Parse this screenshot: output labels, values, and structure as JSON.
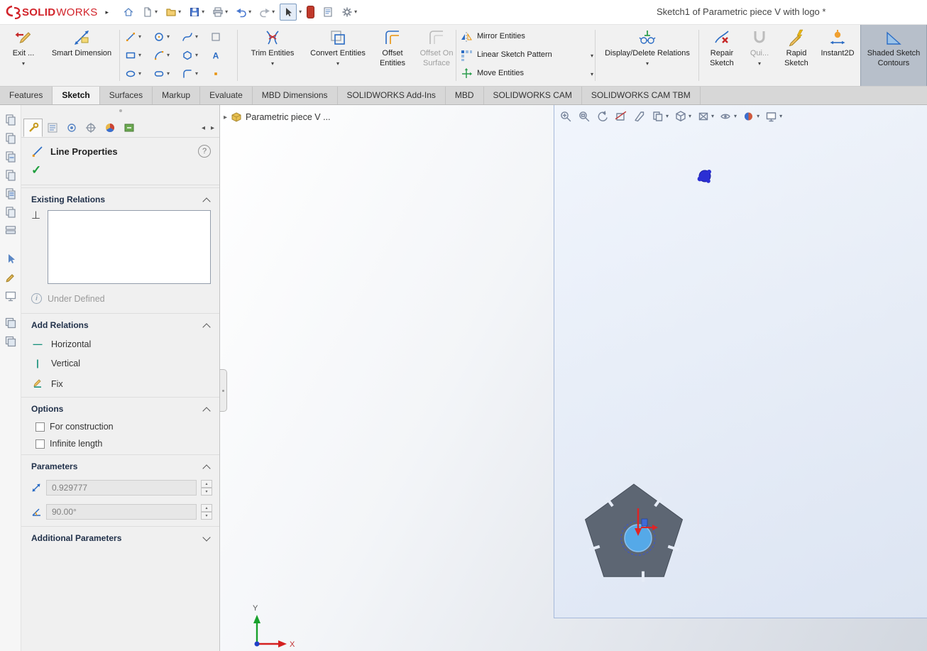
{
  "titlebar": {
    "logo_solid": "SOLID",
    "logo_works": "WORKS",
    "title": "Sketch1 of Parametric piece V with logo *"
  },
  "icons": {
    "dropdown": "▾",
    "spin_up": "▴",
    "spin_down": "▾",
    "nav_left": "◂",
    "nav_right": "▸",
    "crumb_arrow": "▸",
    "logo_expander": "▸",
    "check": "✓",
    "help": "?",
    "info": "i",
    "perpendicular": "⊥",
    "horizontal_glyph": "—",
    "vertical_glyph": "|",
    "text_tool_glyph": "A"
  },
  "ribbon": {
    "exit_sketch": "Exit ...",
    "smart_dimension": "Smart Dimension",
    "trim_entities": "Trim Entities",
    "convert_entities": "Convert Entities",
    "offset_entities": "Offset Entities",
    "offset_on_surface": "Offset On Surface",
    "mirror_entities": "Mirror Entities",
    "linear_sketch_pattern": "Linear Sketch Pattern",
    "move_entities": "Move Entities",
    "display_delete_relations": "Display/Delete Relations",
    "repair_sketch": "Repair Sketch",
    "quick_snaps": "Qui...",
    "rapid_sketch": "Rapid Sketch",
    "instant2d": "Instant2D",
    "shaded_sketch_contours": "Shaded Sketch Contours"
  },
  "tabs": [
    {
      "label": "Features",
      "active": false
    },
    {
      "label": "Sketch",
      "active": true
    },
    {
      "label": "Surfaces",
      "active": false
    },
    {
      "label": "Markup",
      "active": false
    },
    {
      "label": "Evaluate",
      "active": false
    },
    {
      "label": "MBD Dimensions",
      "active": false
    },
    {
      "label": "SOLIDWORKS Add-Ins",
      "active": false
    },
    {
      "label": "MBD",
      "active": false
    },
    {
      "label": "SOLIDWORKS CAM",
      "active": false
    },
    {
      "label": "SOLIDWORKS CAM TBM",
      "active": false
    }
  ],
  "panel": {
    "title": "Line Properties",
    "sections": {
      "existing_relations": "Existing Relations",
      "add_relations": "Add Relations",
      "options": "Options",
      "parameters": "Parameters",
      "additional_parameters": "Additional Parameters"
    },
    "status": "Under Defined",
    "relations": [
      "Horizontal",
      "Vertical",
      "Fix"
    ],
    "checkboxes": [
      {
        "label": "For construction",
        "checked": false
      },
      {
        "label": "Infinite length",
        "checked": false
      }
    ],
    "parameters": {
      "length": "0.929777",
      "angle": "90.00°"
    }
  },
  "viewport": {
    "breadcrumb": "Parametric piece V ...",
    "triad": {
      "x": "X",
      "y": "Y"
    }
  },
  "colors": {
    "accent_red": "#d2232a",
    "part_fill": "#5d6673",
    "sketch_circle": "#55a9e8",
    "origin_red": "#e02424",
    "triad_green": "#18a12c",
    "point_blue": "#2b2fd4",
    "selection_bg": "#b7bfca"
  }
}
